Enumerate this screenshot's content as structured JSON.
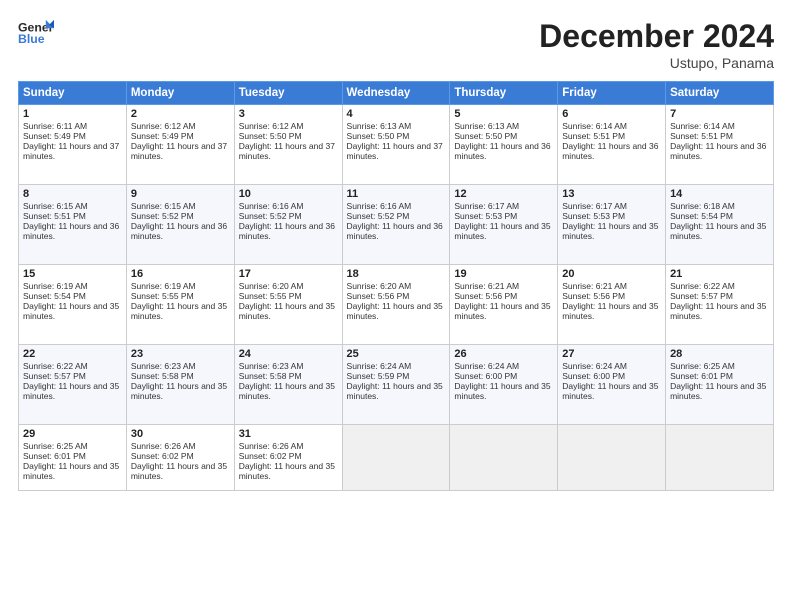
{
  "logo": {
    "line1": "General",
    "line2": "Blue"
  },
  "title": "December 2024",
  "location": "Ustupo, Panama",
  "weekdays": [
    "Sunday",
    "Monday",
    "Tuesday",
    "Wednesday",
    "Thursday",
    "Friday",
    "Saturday"
  ],
  "weeks": [
    [
      {
        "day": 1,
        "sunrise": "6:11 AM",
        "sunset": "5:49 PM",
        "daylight": "11 hours and 37 minutes."
      },
      {
        "day": 2,
        "sunrise": "6:12 AM",
        "sunset": "5:49 PM",
        "daylight": "11 hours and 37 minutes."
      },
      {
        "day": 3,
        "sunrise": "6:12 AM",
        "sunset": "5:50 PM",
        "daylight": "11 hours and 37 minutes."
      },
      {
        "day": 4,
        "sunrise": "6:13 AM",
        "sunset": "5:50 PM",
        "daylight": "11 hours and 37 minutes."
      },
      {
        "day": 5,
        "sunrise": "6:13 AM",
        "sunset": "5:50 PM",
        "daylight": "11 hours and 36 minutes."
      },
      {
        "day": 6,
        "sunrise": "6:14 AM",
        "sunset": "5:51 PM",
        "daylight": "11 hours and 36 minutes."
      },
      {
        "day": 7,
        "sunrise": "6:14 AM",
        "sunset": "5:51 PM",
        "daylight": "11 hours and 36 minutes."
      }
    ],
    [
      {
        "day": 8,
        "sunrise": "6:15 AM",
        "sunset": "5:51 PM",
        "daylight": "11 hours and 36 minutes."
      },
      {
        "day": 9,
        "sunrise": "6:15 AM",
        "sunset": "5:52 PM",
        "daylight": "11 hours and 36 minutes."
      },
      {
        "day": 10,
        "sunrise": "6:16 AM",
        "sunset": "5:52 PM",
        "daylight": "11 hours and 36 minutes."
      },
      {
        "day": 11,
        "sunrise": "6:16 AM",
        "sunset": "5:52 PM",
        "daylight": "11 hours and 36 minutes."
      },
      {
        "day": 12,
        "sunrise": "6:17 AM",
        "sunset": "5:53 PM",
        "daylight": "11 hours and 35 minutes."
      },
      {
        "day": 13,
        "sunrise": "6:17 AM",
        "sunset": "5:53 PM",
        "daylight": "11 hours and 35 minutes."
      },
      {
        "day": 14,
        "sunrise": "6:18 AM",
        "sunset": "5:54 PM",
        "daylight": "11 hours and 35 minutes."
      }
    ],
    [
      {
        "day": 15,
        "sunrise": "6:19 AM",
        "sunset": "5:54 PM",
        "daylight": "11 hours and 35 minutes."
      },
      {
        "day": 16,
        "sunrise": "6:19 AM",
        "sunset": "5:55 PM",
        "daylight": "11 hours and 35 minutes."
      },
      {
        "day": 17,
        "sunrise": "6:20 AM",
        "sunset": "5:55 PM",
        "daylight": "11 hours and 35 minutes."
      },
      {
        "day": 18,
        "sunrise": "6:20 AM",
        "sunset": "5:56 PM",
        "daylight": "11 hours and 35 minutes."
      },
      {
        "day": 19,
        "sunrise": "6:21 AM",
        "sunset": "5:56 PM",
        "daylight": "11 hours and 35 minutes."
      },
      {
        "day": 20,
        "sunrise": "6:21 AM",
        "sunset": "5:56 PM",
        "daylight": "11 hours and 35 minutes."
      },
      {
        "day": 21,
        "sunrise": "6:22 AM",
        "sunset": "5:57 PM",
        "daylight": "11 hours and 35 minutes."
      }
    ],
    [
      {
        "day": 22,
        "sunrise": "6:22 AM",
        "sunset": "5:57 PM",
        "daylight": "11 hours and 35 minutes."
      },
      {
        "day": 23,
        "sunrise": "6:23 AM",
        "sunset": "5:58 PM",
        "daylight": "11 hours and 35 minutes."
      },
      {
        "day": 24,
        "sunrise": "6:23 AM",
        "sunset": "5:58 PM",
        "daylight": "11 hours and 35 minutes."
      },
      {
        "day": 25,
        "sunrise": "6:24 AM",
        "sunset": "5:59 PM",
        "daylight": "11 hours and 35 minutes."
      },
      {
        "day": 26,
        "sunrise": "6:24 AM",
        "sunset": "6:00 PM",
        "daylight": "11 hours and 35 minutes."
      },
      {
        "day": 27,
        "sunrise": "6:24 AM",
        "sunset": "6:00 PM",
        "daylight": "11 hours and 35 minutes."
      },
      {
        "day": 28,
        "sunrise": "6:25 AM",
        "sunset": "6:01 PM",
        "daylight": "11 hours and 35 minutes."
      }
    ],
    [
      {
        "day": 29,
        "sunrise": "6:25 AM",
        "sunset": "6:01 PM",
        "daylight": "11 hours and 35 minutes."
      },
      {
        "day": 30,
        "sunrise": "6:26 AM",
        "sunset": "6:02 PM",
        "daylight": "11 hours and 35 minutes."
      },
      {
        "day": 31,
        "sunrise": "6:26 AM",
        "sunset": "6:02 PM",
        "daylight": "11 hours and 35 minutes."
      },
      null,
      null,
      null,
      null
    ]
  ]
}
